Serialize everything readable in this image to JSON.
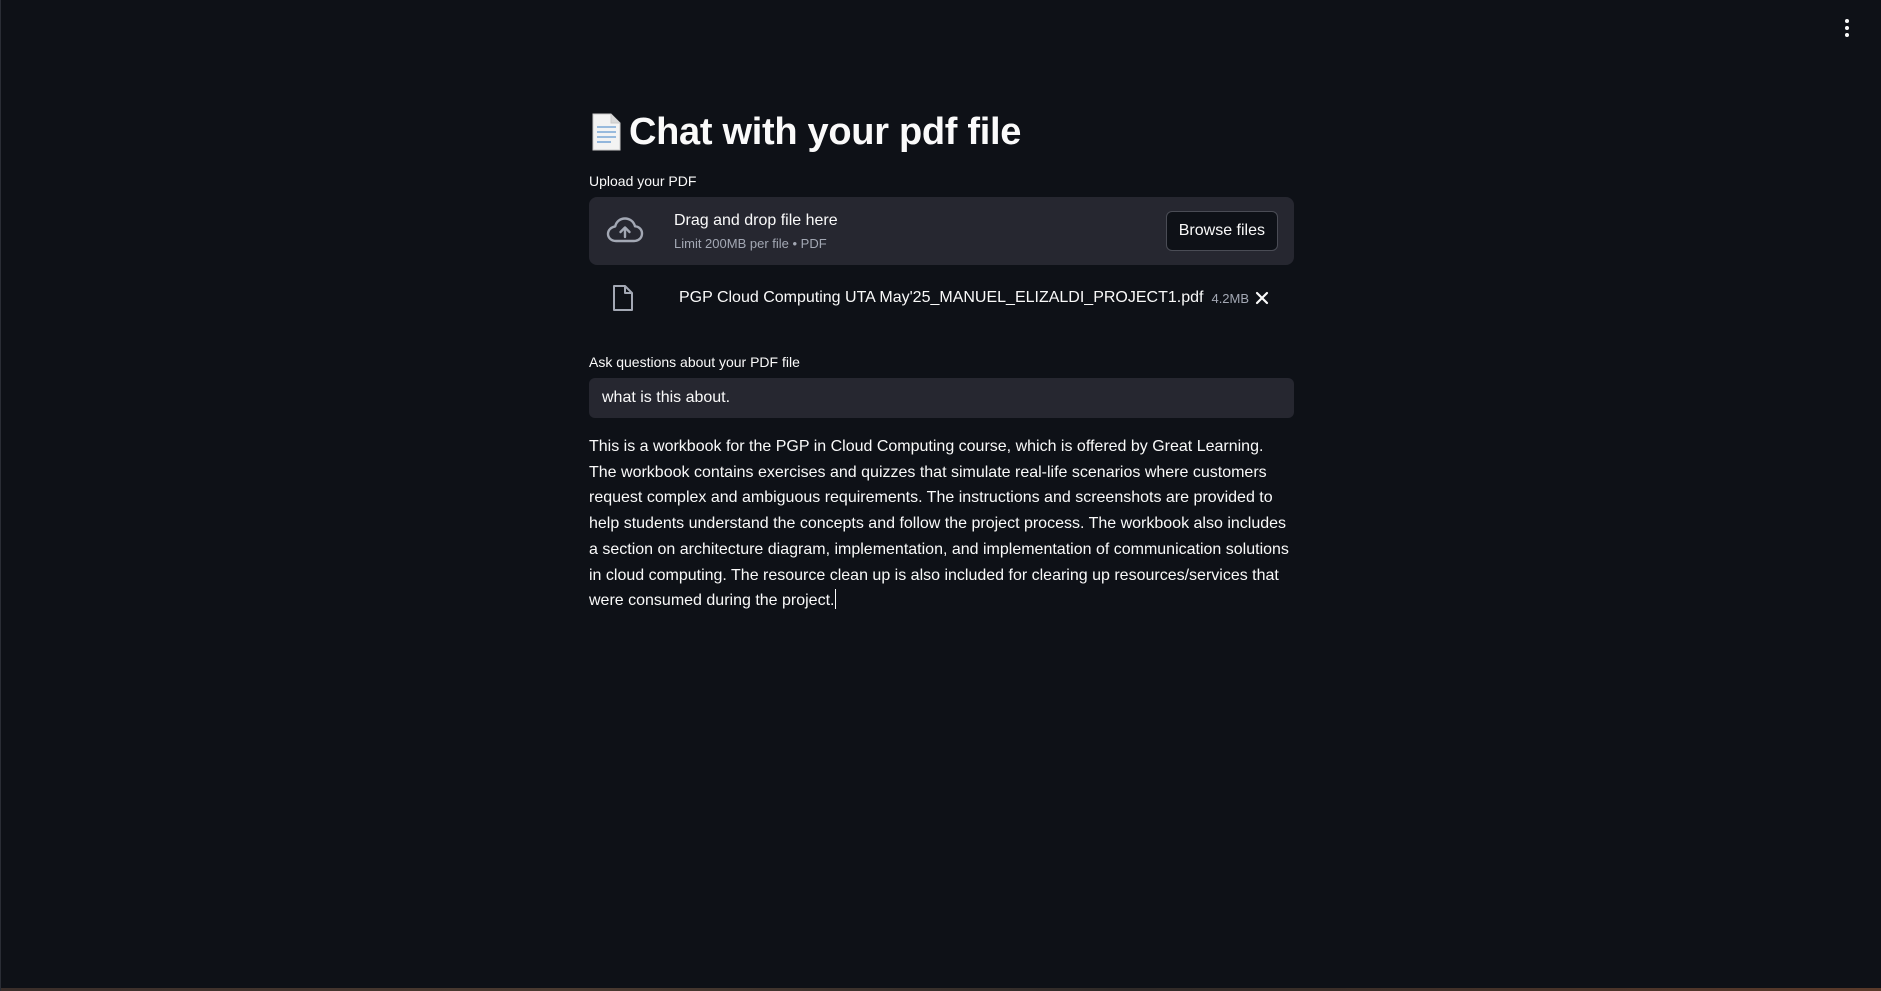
{
  "page": {
    "title_emoji": "📄",
    "title": "Chat with your pdf file"
  },
  "uploader": {
    "label": "Upload your PDF",
    "drop_title": "Drag and drop file here",
    "drop_subtitle": "Limit 200MB per file • PDF",
    "browse_label": "Browse files",
    "icon": "cloud-upload-icon"
  },
  "uploaded_file": {
    "name": "PGP Cloud Computing UTA May'25_MANUEL_ELIZALDI_PROJECT1.pdf",
    "size": "4.2MB",
    "icon": "file-icon",
    "remove_icon": "close-icon"
  },
  "question": {
    "label": "Ask questions about your PDF file",
    "value": "what is this about."
  },
  "answer": {
    "text": "This is a workbook for the PGP in Cloud Computing course, which is offered by Great Learning. The workbook contains exercises and quizzes that simulate real-life scenarios where customers request complex and ambiguous requirements. The instructions and screenshots are provided to help students understand the concepts and follow the project process. The workbook also includes a section on architecture diagram, implementation, and implementation of communication solutions in cloud computing. The resource clean up is also included for clearing up resources/services that were consumed during the project."
  },
  "theme": {
    "background": "#0e1117",
    "surface": "#262730",
    "text": "#fafafa",
    "muted_text": "#a3a8b4"
  },
  "header": {
    "menu_icon": "kebab-menu-icon"
  }
}
